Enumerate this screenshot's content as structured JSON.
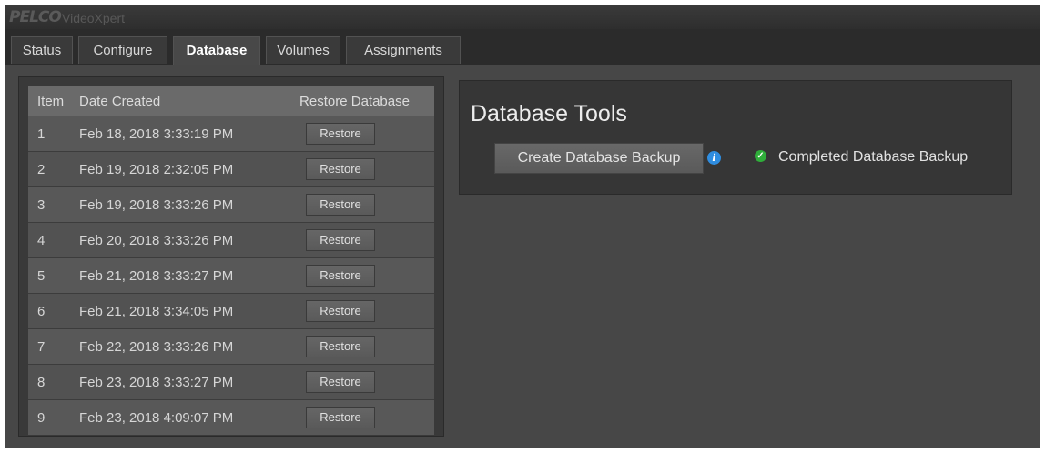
{
  "app": {
    "brand": "PELCO",
    "product": "VideoXpert"
  },
  "tabs": [
    {
      "label": "Status"
    },
    {
      "label": "Configure"
    },
    {
      "label": "Database"
    },
    {
      "label": "Volumes"
    },
    {
      "label": "Assignments"
    }
  ],
  "active_tab": "Database",
  "restore_table": {
    "headers": {
      "item": "Item",
      "date": "Date Created",
      "restore": "Restore Database"
    },
    "button_label": "Restore",
    "rows": [
      {
        "item": "1",
        "date": "Feb 18, 2018 3:33:19 PM"
      },
      {
        "item": "2",
        "date": "Feb 19, 2018 2:32:05 PM"
      },
      {
        "item": "3",
        "date": "Feb 19, 2018 3:33:26 PM"
      },
      {
        "item": "4",
        "date": "Feb 20, 2018 3:33:26 PM"
      },
      {
        "item": "5",
        "date": "Feb 21, 2018 3:33:27 PM"
      },
      {
        "item": "6",
        "date": "Feb 21, 2018 3:34:05 PM"
      },
      {
        "item": "7",
        "date": "Feb 22, 2018 3:33:26 PM"
      },
      {
        "item": "8",
        "date": "Feb 23, 2018 3:33:27 PM"
      },
      {
        "item": "9",
        "date": "Feb 23, 2018 4:09:07 PM"
      }
    ]
  },
  "tools": {
    "title": "Database Tools",
    "create_backup_label": "Create Database Backup",
    "info_icon": "info-icon",
    "status_icon": "check-icon",
    "status_text": "Completed Database Backup"
  },
  "colors": {
    "info_blue": "#2f8de0",
    "success_green": "#2fae3a"
  }
}
